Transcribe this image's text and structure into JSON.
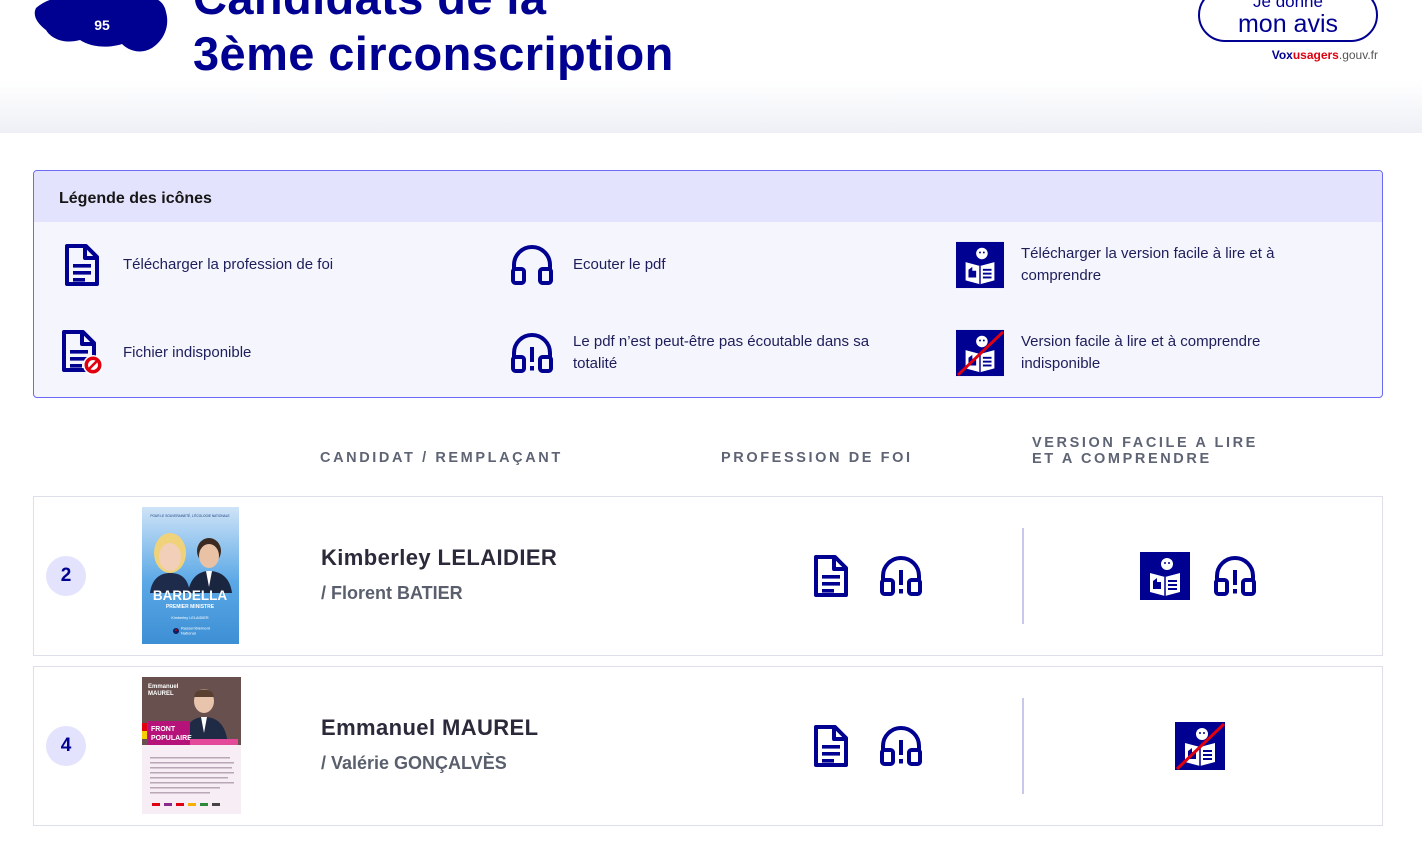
{
  "header": {
    "dept_number": "95",
    "title_line1": "Candidats de la",
    "title_line2": "3ème circonscription",
    "avis_small": "Je donne",
    "avis_big": "mon avis",
    "vox_part1": "Vox",
    "vox_part2": "usagers",
    "vox_part3": ".gouv.fr"
  },
  "legend": {
    "title": "Légende des icônes",
    "items": [
      {
        "icon": "document-icon",
        "text": "Télécharger la profession de foi"
      },
      {
        "icon": "headphones-icon",
        "text": "Ecouter le pdf"
      },
      {
        "icon": "easy-read-icon",
        "text": "Télécharger la version facile à lire et à comprendre"
      },
      {
        "icon": "document-unavailable-icon",
        "text": "Fichier indisponible"
      },
      {
        "icon": "headphones-warning-icon",
        "text": "Le pdf n’est peut-être pas écoutable dans sa totalité"
      },
      {
        "icon": "easy-read-unavailable-icon",
        "text": "Version facile à lire et à comprendre indisponible"
      }
    ]
  },
  "columns": {
    "candidate": "CANDIDAT / REMPLAÇANT",
    "profession": "PROFESSION DE FOI",
    "easy_line1": "VERSION FACILE A LIRE",
    "easy_line2": "ET A COMPRENDRE"
  },
  "candidates": [
    {
      "number": "2",
      "name": "Kimberley LELAIDIER",
      "substitute": "/ Florent BATIER",
      "poster_top": "POUR LE SOUVERAINETÉ, L'ÉCOLOGIE NATIONALE",
      "poster_big": "BARDELLA",
      "poster_sub": "PREMIER MINISTRE",
      "poster_cand": "Kimberley LELAIDIER",
      "poster_party1": "Rassemblement",
      "poster_party2": "National",
      "icons": [
        "document-icon",
        "headphones-warning-icon",
        "easy-read-icon",
        "headphones-warning-icon"
      ]
    },
    {
      "number": "4",
      "name": "Emmanuel MAUREL",
      "substitute": "/ Valérie GONÇALVÈS",
      "poster_name1": "Emmanuel",
      "poster_name2": "MAUREL",
      "poster_front1": "FRONT",
      "poster_front2": "POPULAIRE",
      "icons": [
        "document-icon",
        "headphones-warning-icon",
        "easy-read-unavailable-icon"
      ]
    }
  ],
  "colors": {
    "primary": "#000091",
    "accent_red": "#e1000f",
    "legend_bg": "#f5f5fe",
    "legend_head_bg": "#e3e3fd"
  }
}
